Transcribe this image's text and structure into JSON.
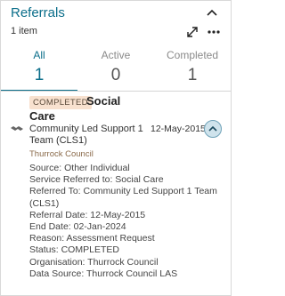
{
  "header": {
    "title": "Referrals",
    "count": "1 item"
  },
  "tabs": [
    {
      "label": "All",
      "count": "1"
    },
    {
      "label": "Active",
      "count": "0"
    },
    {
      "label": "Completed",
      "count": "1"
    }
  ],
  "record": {
    "status_badge": "COMPLETED",
    "title_line1": "Social",
    "title_line2": "Care",
    "team": "Community Led Support 1 Team (CLS1)",
    "date": "12-May-2015",
    "organisation": "Thurrock Council",
    "details": [
      "Source: Other Individual",
      "Service Referred to: Social Care",
      "Referred To: Community Led Support 1 Team",
      "(CLS1)",
      "Referral Date: 12-May-2015",
      "End Date: 02-Jan-2024",
      "Reason: Assessment Request",
      "Status: COMPLETED",
      "Organisation: Thurrock Council",
      "Data Source: Thurrock Council LAS"
    ]
  },
  "icons": {
    "collapse": "chevron-up-icon",
    "expand": "expand-icon",
    "more": "more-icon",
    "record": "handshake-icon",
    "toggle": "chevron-up-icon"
  },
  "colors": {
    "accent": "#0b6e8a",
    "badge_bg": "#f8e1cf",
    "toggle_bg": "#cfe3ec"
  }
}
